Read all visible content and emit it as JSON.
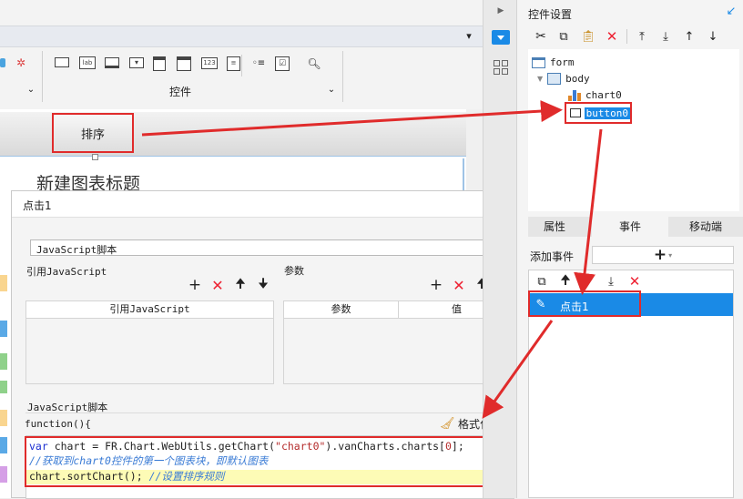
{
  "ribbon": {
    "group_label": "控件",
    "widget_icons": [
      "button-widget-icon",
      "label-widget-icon",
      "text-widget-icon",
      "combo-widget-icon",
      "table-widget-icon",
      "calendar-widget-icon",
      "number-widget-icon",
      "list-widget-icon",
      "radio-widget-icon",
      "checkbox-widget-icon",
      "search-widget-icon"
    ],
    "label_icon_text": "lab",
    "number_icon_text": "123"
  },
  "canvas": {
    "sort_button_label": "排序",
    "chart_title": "新建图表标题"
  },
  "dialog": {
    "title": "点击1",
    "script_type": "JavaScript脚本",
    "ref_js_section": "引用JavaScript",
    "params_section": "参数",
    "ref_js_column": "引用JavaScript",
    "params_columns": [
      "参数",
      "值"
    ],
    "js_section": "JavaScript脚本",
    "function_header": "function(){",
    "format_code_label": "格式化代码",
    "code": {
      "line1_kw": "var",
      "line1_a": " chart = FR.Chart.WebUtils.getChart(",
      "line1_str": "\"chart0\"",
      "line1_b": ").vanCharts.charts[",
      "line1_num": "0",
      "line1_c": "];",
      "line2": "//获取到chart0控件的第一个图表块，即默认图表",
      "line3_a": "chart.sortChart(); ",
      "line3_comment": "//设置排序规则"
    }
  },
  "right_panel": {
    "title": "控件设置",
    "tree": {
      "root": "form",
      "body": "body",
      "chart": "chart0",
      "button": "button0"
    },
    "tabs": [
      "属性",
      "事件",
      "移动端"
    ],
    "active_tab": "事件",
    "add_event_label": "添加事件",
    "add_event_button": "+",
    "event_item": "点击1"
  },
  "colors": {
    "highlight_red": "#e02b2b",
    "selection_blue": "#1a8ae6",
    "code_highlight": "#fdfbb6"
  }
}
